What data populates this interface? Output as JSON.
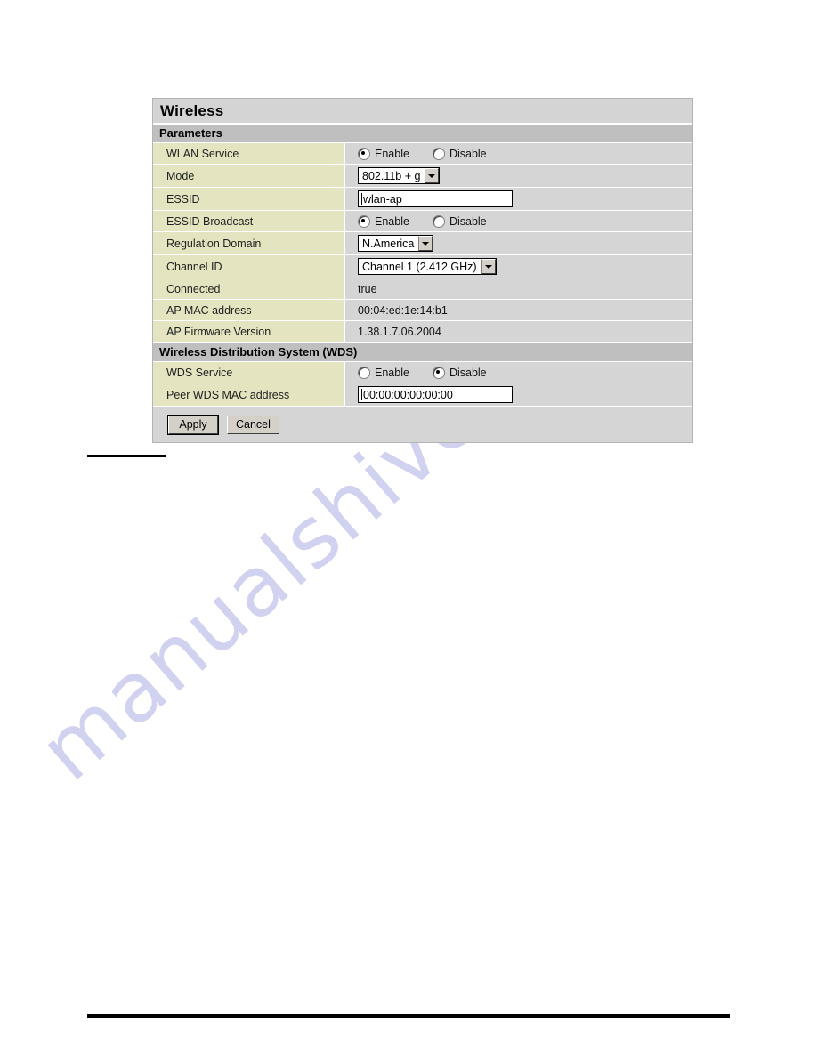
{
  "watermark": {
    "text": "manualshive.com"
  },
  "panel": {
    "title": "Wireless",
    "sections": [
      {
        "heading": "Parameters",
        "rows": [
          {
            "label": "WLAN Service",
            "type": "radio",
            "options": [
              "Enable",
              "Disable"
            ],
            "selected": "Enable"
          },
          {
            "label": "Mode",
            "type": "select",
            "value": "802.11b + g"
          },
          {
            "label": "ESSID",
            "type": "text",
            "value": "wlan-ap"
          },
          {
            "label": "ESSID Broadcast",
            "type": "radio",
            "options": [
              "Enable",
              "Disable"
            ],
            "selected": "Enable"
          },
          {
            "label": "Regulation Domain",
            "type": "select",
            "value": "N.America"
          },
          {
            "label": "Channel ID",
            "type": "select",
            "value": "Channel 1 (2.412 GHz)"
          },
          {
            "label": "Connected",
            "type": "static",
            "value": "true"
          },
          {
            "label": "AP MAC address",
            "type": "static",
            "value": "00:04:ed:1e:14:b1"
          },
          {
            "label": "AP Firmware Version",
            "type": "static",
            "value": "1.38.1.7.06.2004"
          }
        ]
      },
      {
        "heading": "Wireless Distribution System (WDS)",
        "rows": [
          {
            "label": "WDS Service",
            "type": "radio",
            "options": [
              "Enable",
              "Disable"
            ],
            "selected": "Disable"
          },
          {
            "label": "Peer WDS MAC address",
            "type": "text",
            "value": "00:00:00:00:00:00"
          }
        ]
      }
    ],
    "buttons": {
      "apply_label": "Apply",
      "cancel_label": "Cancel"
    }
  },
  "colors": {
    "label_cell": "#e4e4c0",
    "value_cell": "#d5d5d5",
    "section_head": "#bfbfbf",
    "panel_title": "#d4d4d4",
    "watermark": "#c9cbee"
  }
}
